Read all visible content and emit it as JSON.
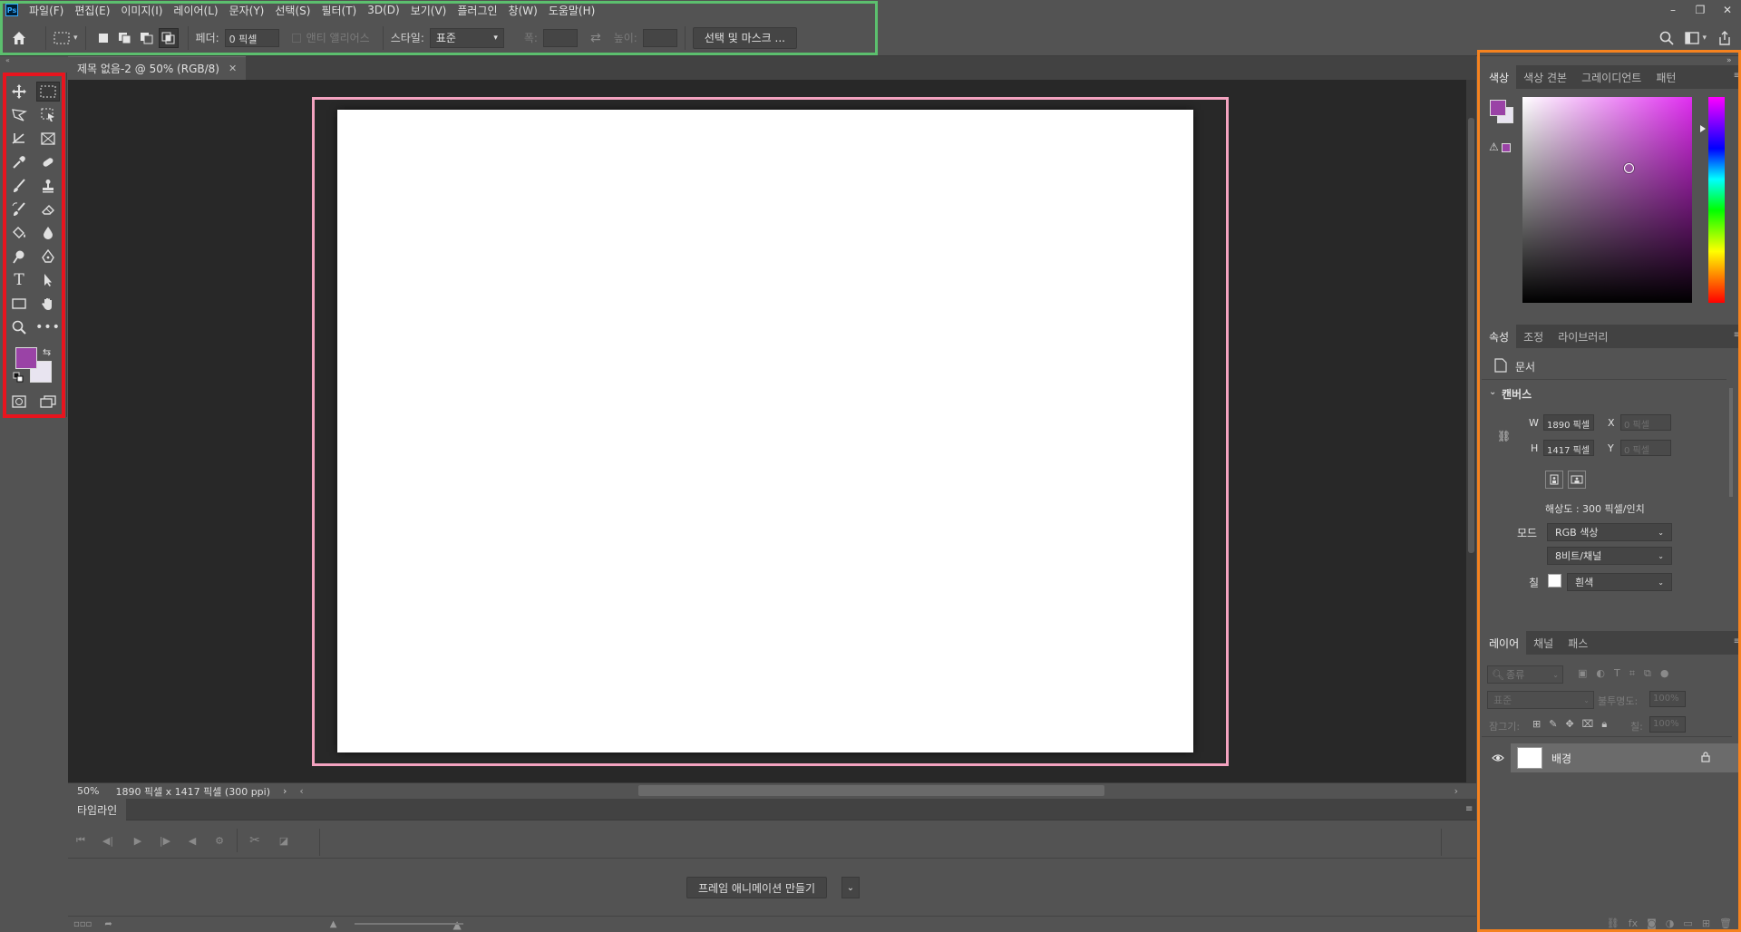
{
  "menubar": {
    "logo": "Ps",
    "items": [
      "파일(F)",
      "편집(E)",
      "이미지(I)",
      "레이어(L)",
      "문자(Y)",
      "선택(S)",
      "필터(T)",
      "3D(D)",
      "보기(V)",
      "플러그인",
      "창(W)",
      "도움말(H)"
    ]
  },
  "options": {
    "feather_label": "페더:",
    "feather_value": "0 픽셀",
    "antialias_label": "앤티 앨리어스",
    "style_label": "스타일:",
    "style_value": "표준",
    "width_label": "폭:",
    "height_label": "높이:",
    "select_mask_button": "선택 및 마스크 ..."
  },
  "document": {
    "tab_title": "제목 없음-2 @ 50% (RGB/8)",
    "zoom": "50%",
    "info": "1890 픽셀 x 1417 픽셀 (300 ppi)"
  },
  "timeline": {
    "tab": "타임라인",
    "create_button": "프레임 애니메이션 만들기"
  },
  "color_panel": {
    "tabs": [
      "색상",
      "색상 견본",
      "그레이디언트",
      "패턴"
    ],
    "foreground": "#9a43a6",
    "background": "#e8e4f0"
  },
  "properties_panel": {
    "tabs": [
      "속성",
      "조정",
      "라이브러리"
    ],
    "type_label": "문서",
    "section": "캔버스",
    "w_label": "W",
    "w_value": "1890 픽셀",
    "h_label": "H",
    "h_value": "1417 픽셀",
    "x_label": "X",
    "x_placeholder": "0 픽셀",
    "y_label": "Y",
    "y_placeholder": "0 픽셀",
    "resolution": "해상도 : 300 픽셀/인치",
    "mode_label": "모드",
    "mode_value": "RGB 색상",
    "depth_value": "8비트/채널",
    "fill_label": "칠",
    "fill_value": "흰색"
  },
  "layers_panel": {
    "tabs": [
      "레이어",
      "채널",
      "패스"
    ],
    "filter_placeholder": "종류",
    "blend_mode": "표준",
    "opacity_label": "불투명도:",
    "opacity_value": "100%",
    "lock_label": "잠그기:",
    "fill_label": "칠:",
    "fill_value": "100%",
    "layer_name": "배경"
  },
  "annotations": {
    "options_color": "#5cbf6e",
    "toolbar_color": "#e8141e",
    "panels_color": "#f5821f",
    "canvas_color": "#f4a3c0"
  }
}
